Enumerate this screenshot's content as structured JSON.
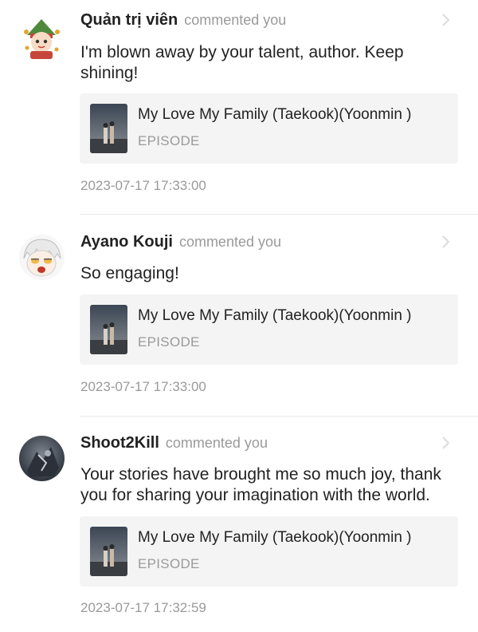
{
  "notifications": [
    {
      "username": "Quản trị viên",
      "action": "commented you",
      "avatar_icon": "admin-mascot-avatar",
      "comment": "I'm blown away by your talent, author. Keep shining!",
      "work": {
        "title": "My Love My Family (Taekook)(Yoonmin )",
        "type": "EPISODE"
      },
      "timestamp": "2023-07-17 17:33:00"
    },
    {
      "username": "Ayano Kouji",
      "action": "commented you",
      "avatar_icon": "anime-character-avatar",
      "comment": "So engaging!",
      "work": {
        "title": "My Love My Family (Taekook)(Yoonmin )",
        "type": "EPISODE"
      },
      "timestamp": "2023-07-17 17:33:00"
    },
    {
      "username": "Shoot2Kill",
      "action": "commented you",
      "avatar_icon": "dark-photo-avatar",
      "comment": "Your stories have brought me so much joy, thank you for sharing your imagination with the world.",
      "work": {
        "title": "My Love My Family (Taekook)(Yoonmin )",
        "type": "EPISODE"
      },
      "timestamp": "2023-07-17 17:32:59"
    }
  ],
  "colors": {
    "text": "#222222",
    "muted": "#9a9a9a",
    "card_bg": "#f4f4f4",
    "divider": "#e8e8e8"
  }
}
